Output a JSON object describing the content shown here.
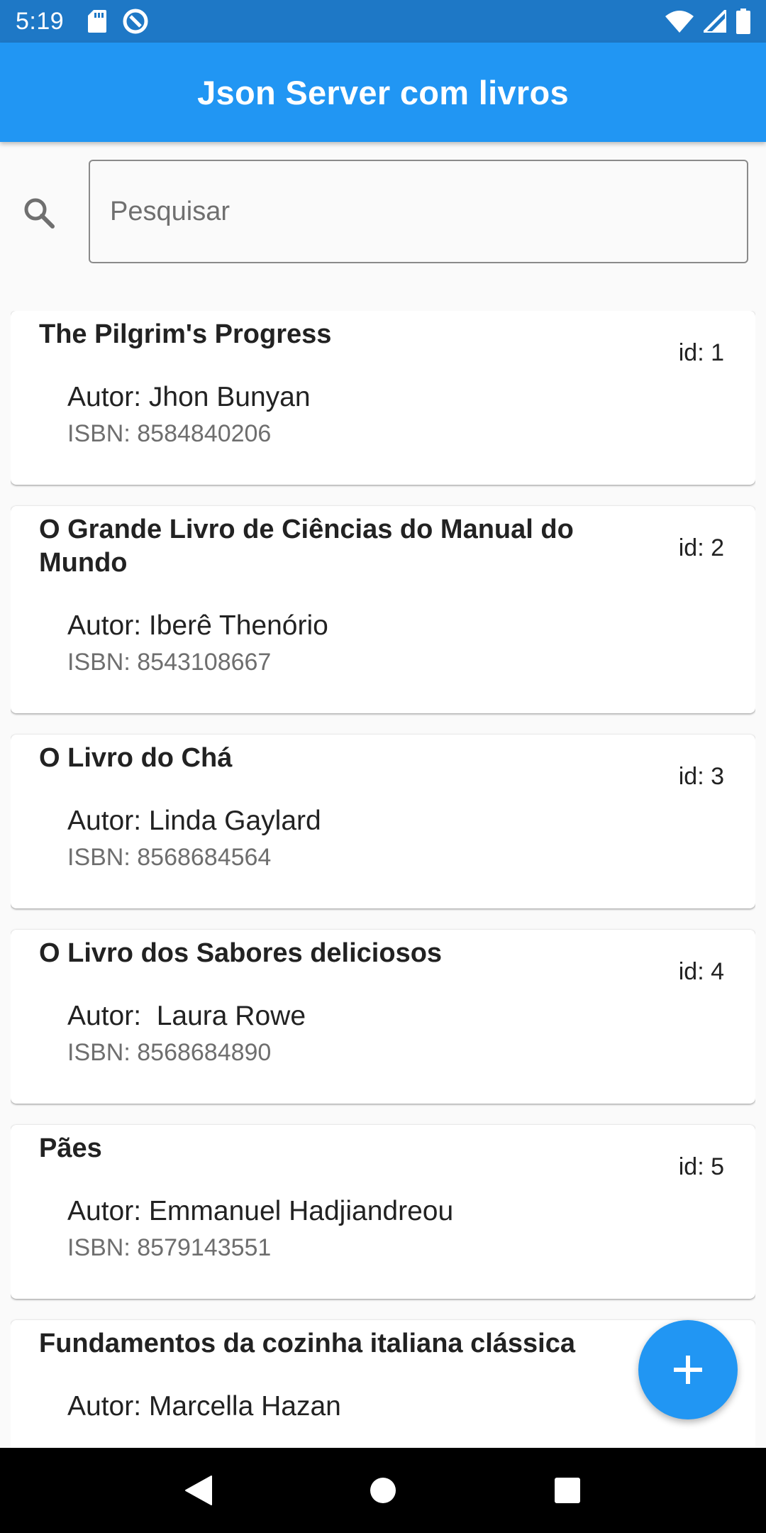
{
  "status_bar": {
    "time": "5:19",
    "left_icons": [
      "sd-card-icon",
      "data-saver-icon"
    ],
    "right_icons": [
      "wifi-icon",
      "signal-icon",
      "battery-icon"
    ]
  },
  "app_bar": {
    "title": "Json Server com livros"
  },
  "search": {
    "placeholder": "Pesquisar",
    "value": "",
    "icon": "search-icon"
  },
  "books": [
    {
      "title": "The Pilgrim's Progress",
      "id_label": "id: 1",
      "author": "Autor: Jhon Bunyan",
      "isbn": "ISBN: 8584840206"
    },
    {
      "title": "O Grande Livro de Ciências do Manual do Mundo",
      "id_label": "id: 2",
      "author": "Autor: Iberê Thenório",
      "isbn": "ISBN: 8543108667"
    },
    {
      "title": "O Livro do Chá",
      "id_label": "id: 3",
      "author": "Autor: Linda Gaylard",
      "isbn": "ISBN: 8568684564"
    },
    {
      "title": "O Livro dos Sabores deliciosos",
      "id_label": "id: 4",
      "author": "Autor:  Laura Rowe",
      "isbn": "ISBN: 8568684890"
    },
    {
      "title": "Pães",
      "id_label": "id: 5",
      "author": "Autor: Emmanuel Hadjiandreou",
      "isbn": "ISBN: 8579143551"
    },
    {
      "title": "Fundamentos da cozinha italiana clássica",
      "id_label": "",
      "author": "Autor: Marcella Hazan",
      "isbn": ""
    }
  ],
  "fab": {
    "icon": "plus-icon"
  },
  "nav_bar": {
    "buttons": [
      "back-icon",
      "home-icon",
      "recents-icon"
    ]
  },
  "colors": {
    "status_bar": "#1e78c6",
    "app_bar": "#2196f3",
    "accent": "#2196f3",
    "background": "#fafafa"
  }
}
